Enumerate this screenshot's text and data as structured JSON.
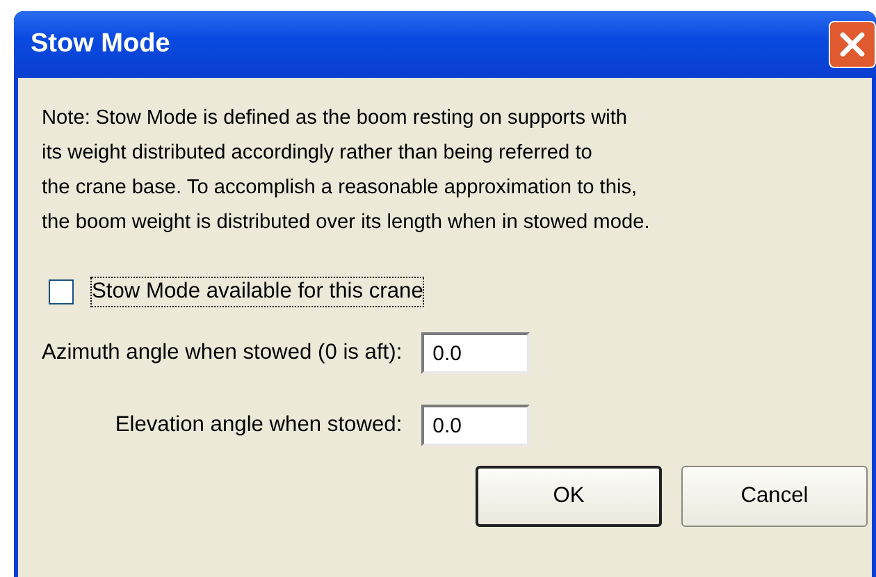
{
  "window": {
    "title": "Stow Mode"
  },
  "note_lines": [
    "Note: Stow Mode is defined as the boom resting on supports with",
    "its weight distributed accordingly rather than being referred to",
    "the crane base.  To accomplish a reasonable approximation to this,",
    "the boom weight is distributed over its length when in stowed mode."
  ],
  "checkbox": {
    "label": "Stow Mode available for this crane",
    "checked": false,
    "focused": true
  },
  "fields": [
    {
      "label": "Azimuth angle when stowed (0 is aft):",
      "value": "0.0"
    },
    {
      "label": "Elevation angle when stowed:",
      "value": "0.0"
    }
  ],
  "buttons": [
    {
      "label": "OK",
      "default": true
    },
    {
      "label": "Cancel",
      "default": false
    }
  ]
}
